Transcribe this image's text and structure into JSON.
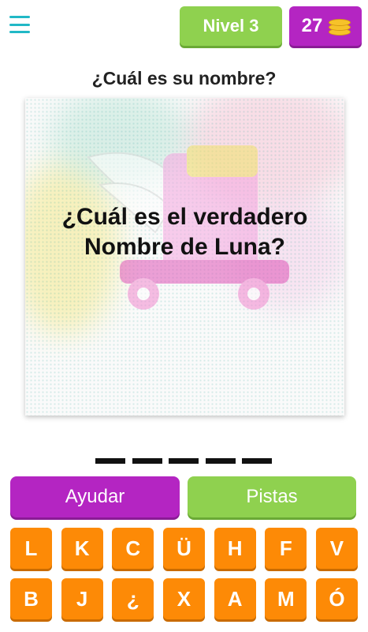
{
  "header": {
    "level_label": "Nivel 3",
    "coins": "27"
  },
  "question": {
    "title": "¿Cuál es su nombre?",
    "card_text": "¿Cuál es el verdadero\nNombre de Luna?"
  },
  "answer": {
    "slots": 5
  },
  "actions": {
    "help_label": "Ayudar",
    "hints_label": "Pistas"
  },
  "keyboard": {
    "row1": [
      "L",
      "K",
      "C",
      "Ü",
      "H",
      "F",
      "V"
    ],
    "row2": [
      "B",
      "J",
      "¿",
      "X",
      "A",
      "M",
      "Ó"
    ]
  },
  "colors": {
    "green": "#8fd14f",
    "purple": "#b425c2",
    "orange": "#fd8a06",
    "teal": "#21b8c6"
  },
  "icons": {
    "menu": "hamburger-menu-icon",
    "coins": "coin-stack-icon"
  }
}
